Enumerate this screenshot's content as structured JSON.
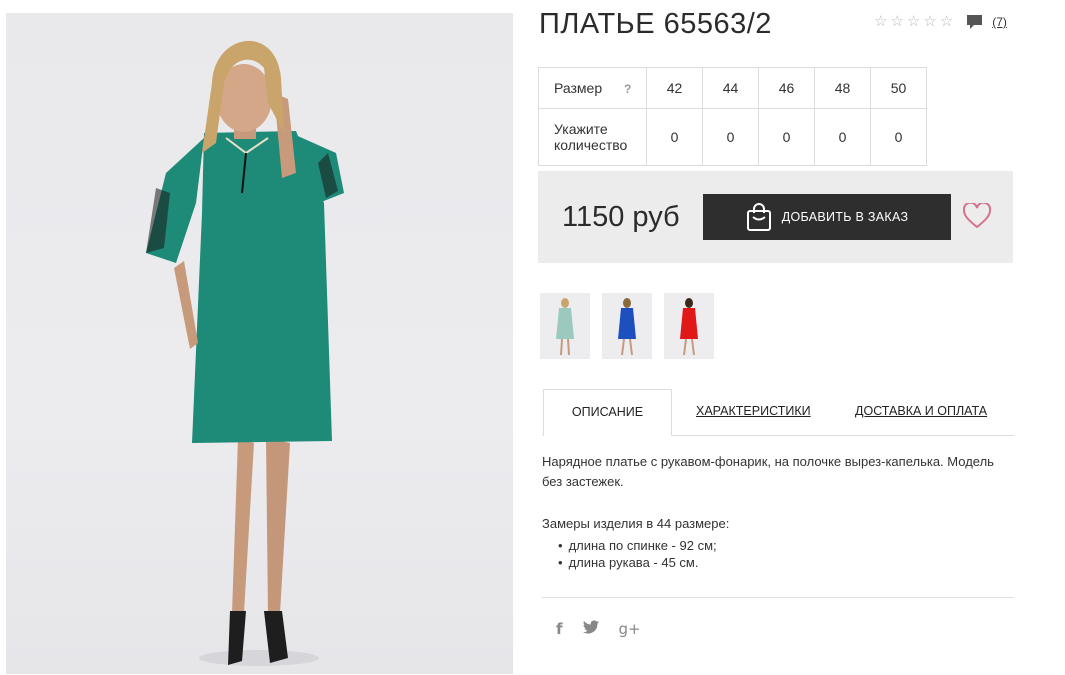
{
  "product": {
    "title": "ПЛАТЬЕ 65563/2",
    "review_count": "(7)",
    "stars_total": 5,
    "stars_filled": 0,
    "size_label": "Размер",
    "size_help": "?",
    "sizes": [
      "42",
      "44",
      "46",
      "48",
      "50"
    ],
    "qty_label_1": "Укажите",
    "qty_label_2": "количество",
    "quantities": [
      "0",
      "0",
      "0",
      "0",
      "0"
    ],
    "price": "1150 руб",
    "add_button": "ДОБАВИТЬ В ЗАКАЗ",
    "thumbnails": [
      {
        "color_name": "mint",
        "dress_color": "#9cc9be"
      },
      {
        "color_name": "blue",
        "dress_color": "#1e4fbf"
      },
      {
        "color_name": "red",
        "dress_color": "#e01818"
      }
    ],
    "main_dress_color": "#1e8a78"
  },
  "tabs": {
    "description": "ОПИСАНИЕ",
    "characteristics": "ХАРАКТЕРИСТИКИ",
    "delivery": "ДОСТАВКА И ОПЛАТА"
  },
  "description": {
    "text": "Нарядное платье с рукавом-фонарик, на полочке вырез-капелька. Модель без застежек.",
    "measure_title": "Замеры изделия в 44 размере:",
    "measures": [
      "длина по спинке - 92 см;",
      "длина рукава - 45 см."
    ]
  },
  "social": {
    "facebook": "f",
    "twitter": "twitter-icon",
    "google": "g+"
  },
  "colors": {
    "button_bg": "#2e2e2e",
    "heart": "#d9708a",
    "buybox_bg": "#ececec"
  }
}
